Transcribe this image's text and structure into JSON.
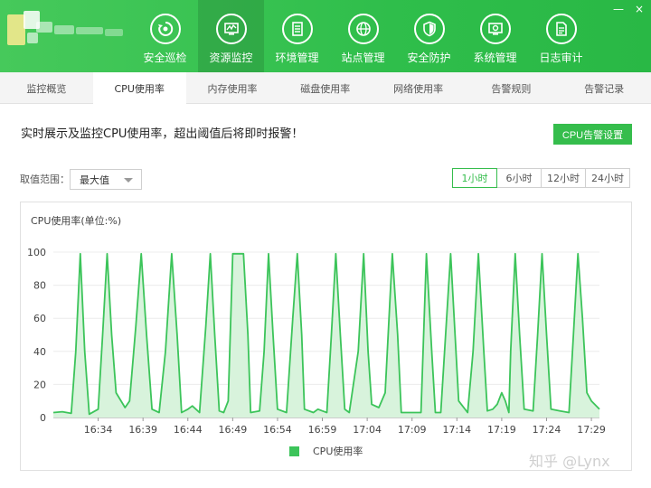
{
  "window": {
    "controls": [
      "—",
      "×"
    ]
  },
  "nav": {
    "items": [
      {
        "label": "安全巡检",
        "icon": "refresh-shield-icon",
        "active": false
      },
      {
        "label": "资源监控",
        "icon": "monitor-chart-icon",
        "active": true
      },
      {
        "label": "环境管理",
        "icon": "server-icon",
        "active": false
      },
      {
        "label": "站点管理",
        "icon": "globe-icon",
        "active": false
      },
      {
        "label": "安全防护",
        "icon": "shield-icon",
        "active": false
      },
      {
        "label": "系统管理",
        "icon": "gear-screen-icon",
        "active": false
      },
      {
        "label": "日志审计",
        "icon": "document-icon",
        "active": false
      }
    ]
  },
  "tabs": {
    "items": [
      "监控概览",
      "CPU使用率",
      "内存使用率",
      "磁盘使用率",
      "网络使用率",
      "告警规则",
      "告警记录"
    ],
    "active_index": 1
  },
  "content": {
    "description": "实时展示及监控CPU使用率，超出阈值后将即时报警！",
    "alarm_button": "CPU告警设置",
    "range_label": "取值范围：",
    "range_value": "最大值",
    "time_buttons": [
      "1小时",
      "6小时",
      "12小时",
      "24小时"
    ],
    "time_active_index": 0
  },
  "watermark": "知乎 @Lynx",
  "chart_data": {
    "type": "area",
    "title": "CPU使用率(单位:%)",
    "ylim": [
      0,
      100
    ],
    "yticks": [
      0,
      20,
      40,
      60,
      80,
      100
    ],
    "xtick_labels": [
      "16:34",
      "16:39",
      "16:44",
      "16:49",
      "16:54",
      "16:59",
      "17:04",
      "17:09",
      "17:14",
      "17:19",
      "17:24",
      "17:29"
    ],
    "xtick_positions": [
      5,
      10,
      15,
      20,
      25,
      30,
      35,
      40,
      45,
      50,
      55,
      60
    ],
    "x_range": [
      0,
      60.9
    ],
    "grid": true,
    "legend_position": "bottom-center",
    "color": "#3cc45a",
    "fill": "#d8f3dc",
    "series": [
      {
        "name": "CPU使用率",
        "points": [
          [
            0,
            3
          ],
          [
            1,
            3.5
          ],
          [
            2,
            2.5
          ],
          [
            2.5,
            40
          ],
          [
            3,
            99
          ],
          [
            3.5,
            40
          ],
          [
            4,
            2
          ],
          [
            5,
            5
          ],
          [
            5.5,
            50
          ],
          [
            6,
            99
          ],
          [
            6.5,
            50
          ],
          [
            7,
            15
          ],
          [
            8,
            6
          ],
          [
            8.5,
            10
          ],
          [
            9.2,
            55
          ],
          [
            9.8,
            99
          ],
          [
            10.4,
            50
          ],
          [
            11,
            5
          ],
          [
            11.8,
            3
          ],
          [
            12.5,
            40
          ],
          [
            13.2,
            99
          ],
          [
            13.8,
            50
          ],
          [
            14.3,
            3
          ],
          [
            15,
            5
          ],
          [
            15.5,
            7
          ],
          [
            16.3,
            3
          ],
          [
            17,
            55
          ],
          [
            17.5,
            99
          ],
          [
            18,
            50
          ],
          [
            18.5,
            4
          ],
          [
            19,
            3
          ],
          [
            19.5,
            10
          ],
          [
            20,
            99
          ],
          [
            21.2,
            99
          ],
          [
            21.7,
            50
          ],
          [
            22,
            3
          ],
          [
            23,
            4
          ],
          [
            23.5,
            40
          ],
          [
            24,
            99
          ],
          [
            24.5,
            50
          ],
          [
            25,
            5
          ],
          [
            26,
            3
          ],
          [
            26.7,
            60
          ],
          [
            27.2,
            99
          ],
          [
            27.7,
            50
          ],
          [
            28,
            5
          ],
          [
            29,
            3
          ],
          [
            29.5,
            5
          ],
          [
            30,
            4
          ],
          [
            30.5,
            3
          ],
          [
            31,
            50
          ],
          [
            31.5,
            99
          ],
          [
            32,
            50
          ],
          [
            32.5,
            5
          ],
          [
            33,
            3
          ],
          [
            34,
            40
          ],
          [
            34.6,
            99
          ],
          [
            35.1,
            40
          ],
          [
            35.5,
            8
          ],
          [
            36.3,
            6
          ],
          [
            37,
            15
          ],
          [
            37.8,
            99
          ],
          [
            38.4,
            50
          ],
          [
            38.8,
            3
          ],
          [
            40,
            3
          ],
          [
            41,
            3
          ],
          [
            41.6,
            99
          ],
          [
            42.2,
            40
          ],
          [
            42.6,
            3
          ],
          [
            43.2,
            3
          ],
          [
            43.8,
            55
          ],
          [
            44.3,
            99
          ],
          [
            44.8,
            50
          ],
          [
            45.2,
            10
          ],
          [
            46.2,
            3
          ],
          [
            46.8,
            40
          ],
          [
            47.4,
            99
          ],
          [
            48,
            40
          ],
          [
            48.4,
            4
          ],
          [
            49,
            5
          ],
          [
            49.5,
            8
          ],
          [
            50,
            15
          ],
          [
            50.4,
            10
          ],
          [
            50.8,
            3
          ],
          [
            51,
            40
          ],
          [
            51.5,
            99
          ],
          [
            52,
            50
          ],
          [
            52.5,
            5
          ],
          [
            53.5,
            4
          ],
          [
            54,
            50
          ],
          [
            54.5,
            99
          ],
          [
            55,
            50
          ],
          [
            55.5,
            5
          ],
          [
            56.5,
            4
          ],
          [
            57.5,
            3
          ],
          [
            58,
            50
          ],
          [
            58.5,
            99
          ],
          [
            59,
            60
          ],
          [
            59.5,
            15
          ],
          [
            60,
            10
          ],
          [
            60.9,
            5
          ]
        ]
      }
    ]
  }
}
